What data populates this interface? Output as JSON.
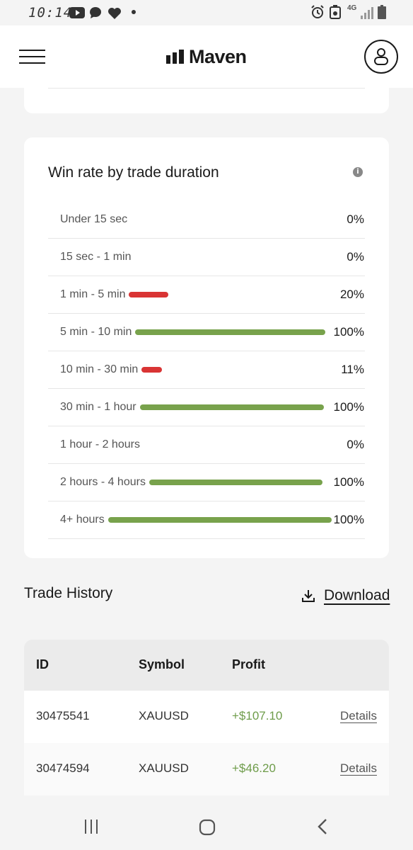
{
  "status_bar": {
    "time": "10:14",
    "network": "4G",
    "icons": [
      "youtube-icon",
      "chat-bubble-icon",
      "heart-icon",
      "dot-icon",
      "alarm-icon",
      "recycle-icon",
      "signal-icon",
      "battery-icon"
    ]
  },
  "header": {
    "logo_text": "Maven",
    "menu_icon": "hamburger-menu-icon",
    "account_icon": "user-account-icon"
  },
  "win_rate": {
    "title": "Win rate by trade duration",
    "info_icon": "info-icon",
    "rows": [
      {
        "label": "Under 15 sec",
        "value": 0,
        "display": "0%"
      },
      {
        "label": "15 sec - 1 min",
        "value": 0,
        "display": "0%"
      },
      {
        "label": "1 min - 5 min",
        "value": 20,
        "display": "20%"
      },
      {
        "label": "5 min - 10 min",
        "value": 100,
        "display": "100%"
      },
      {
        "label": "10 min - 30 min",
        "value": 11,
        "display": "11%"
      },
      {
        "label": "30 min - 1 hour",
        "value": 100,
        "display": "100%"
      },
      {
        "label": "1 hour - 2 hours",
        "value": 0,
        "display": "0%"
      },
      {
        "label": "2 hours - 4 hours",
        "value": 100,
        "display": "100%"
      },
      {
        "label": "4+ hours",
        "value": 100,
        "display": "100%"
      }
    ],
    "colors": {
      "win": "#78a24c",
      "loss": "#d93434"
    }
  },
  "trade_history": {
    "title": "Trade History",
    "download_label": "Download",
    "download_icon": "download-icon",
    "columns": [
      "ID",
      "Symbol",
      "Profit"
    ],
    "rows": [
      {
        "id": "30475541",
        "symbol": "XAUUSD",
        "profit": "+$107.10",
        "details": "Details"
      },
      {
        "id": "30474594",
        "symbol": "XAUUSD",
        "profit": "+$46.20",
        "details": "Details"
      }
    ]
  },
  "nav_bar": {
    "icons": [
      "recent-apps-icon",
      "home-icon",
      "back-icon"
    ]
  }
}
